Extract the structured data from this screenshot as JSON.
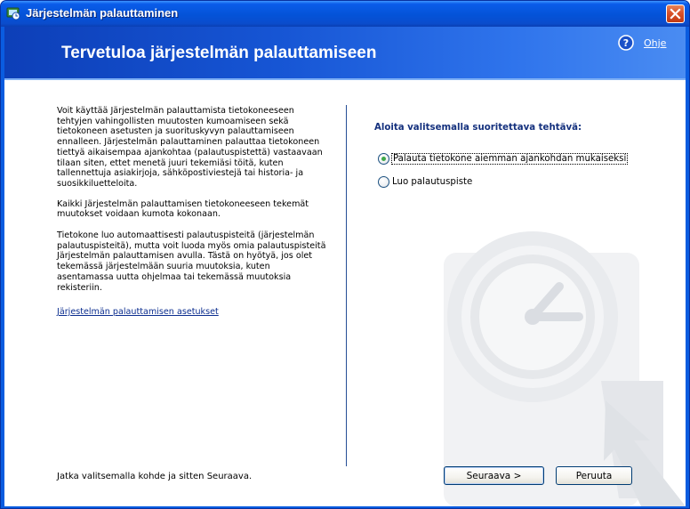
{
  "window": {
    "title": "Järjestelmän palauttaminen"
  },
  "header": {
    "title": "Tervetuloa järjestelmän palauttamiseen",
    "help_label": "Ohje"
  },
  "intro": {
    "paragraph_1": "Voit käyttää Järjestelmän palauttamista tietokoneeseen tehtyjen vahingollisten muutosten kumoamiseen sekä tietokoneen asetusten ja suorituskyvyn palauttamiseen ennalleen. Järjestelmän palauttaminen palauttaa tietokoneen tiettyä aikaisempaa ajankohtaa (palautuspistettä) vastaavaan tilaan siten, ettet menetä juuri tekemiäsi töitä, kuten tallennettuja asiakirjoja, sähköpostiviestejä tai historia- ja suosikkiluetteloita.",
    "paragraph_2": "Kaikki Järjestelmän palauttamisen tietokoneeseen tekemät muutokset voidaan kumota kokonaan.",
    "paragraph_3": "Tietokone luo automaattisesti palautuspisteitä (järjestelmän palautuspisteitä), mutta voit luoda myös omia palautuspisteitä Järjestelmän palauttamisen avulla. Tästä on hyötyä, jos olet tekemässä järjestelmään suuria muutoksia, kuten asentamassa uutta ohjelmaa tai tekemässä muutoksia rekisteriin.",
    "settings_link": "Järjestelmän palauttamisen asetukset"
  },
  "task": {
    "heading": "Aloita valitsemalla suoritettava tehtävä:",
    "options": [
      {
        "label": "Palauta tietokone aiemman ajankohdan mukaiseksi",
        "selected": true
      },
      {
        "label": "Luo palautuspiste",
        "selected": false
      }
    ]
  },
  "footer": {
    "hint": "Jatka valitsemalla kohde ja sitten Seuraava.",
    "next_label": "Seuraava >",
    "cancel_label": "Peruuta"
  },
  "colors": {
    "title_bar": "#0a5ce0",
    "header_band": "#1655d4",
    "close_button": "#d9522a",
    "radio_selected": "#3fa84a",
    "heading_text": "#15317e"
  },
  "icons": {
    "app": "system-restore-icon",
    "close": "close-icon",
    "help": "help-icon",
    "watermark": "clock-watermark"
  }
}
